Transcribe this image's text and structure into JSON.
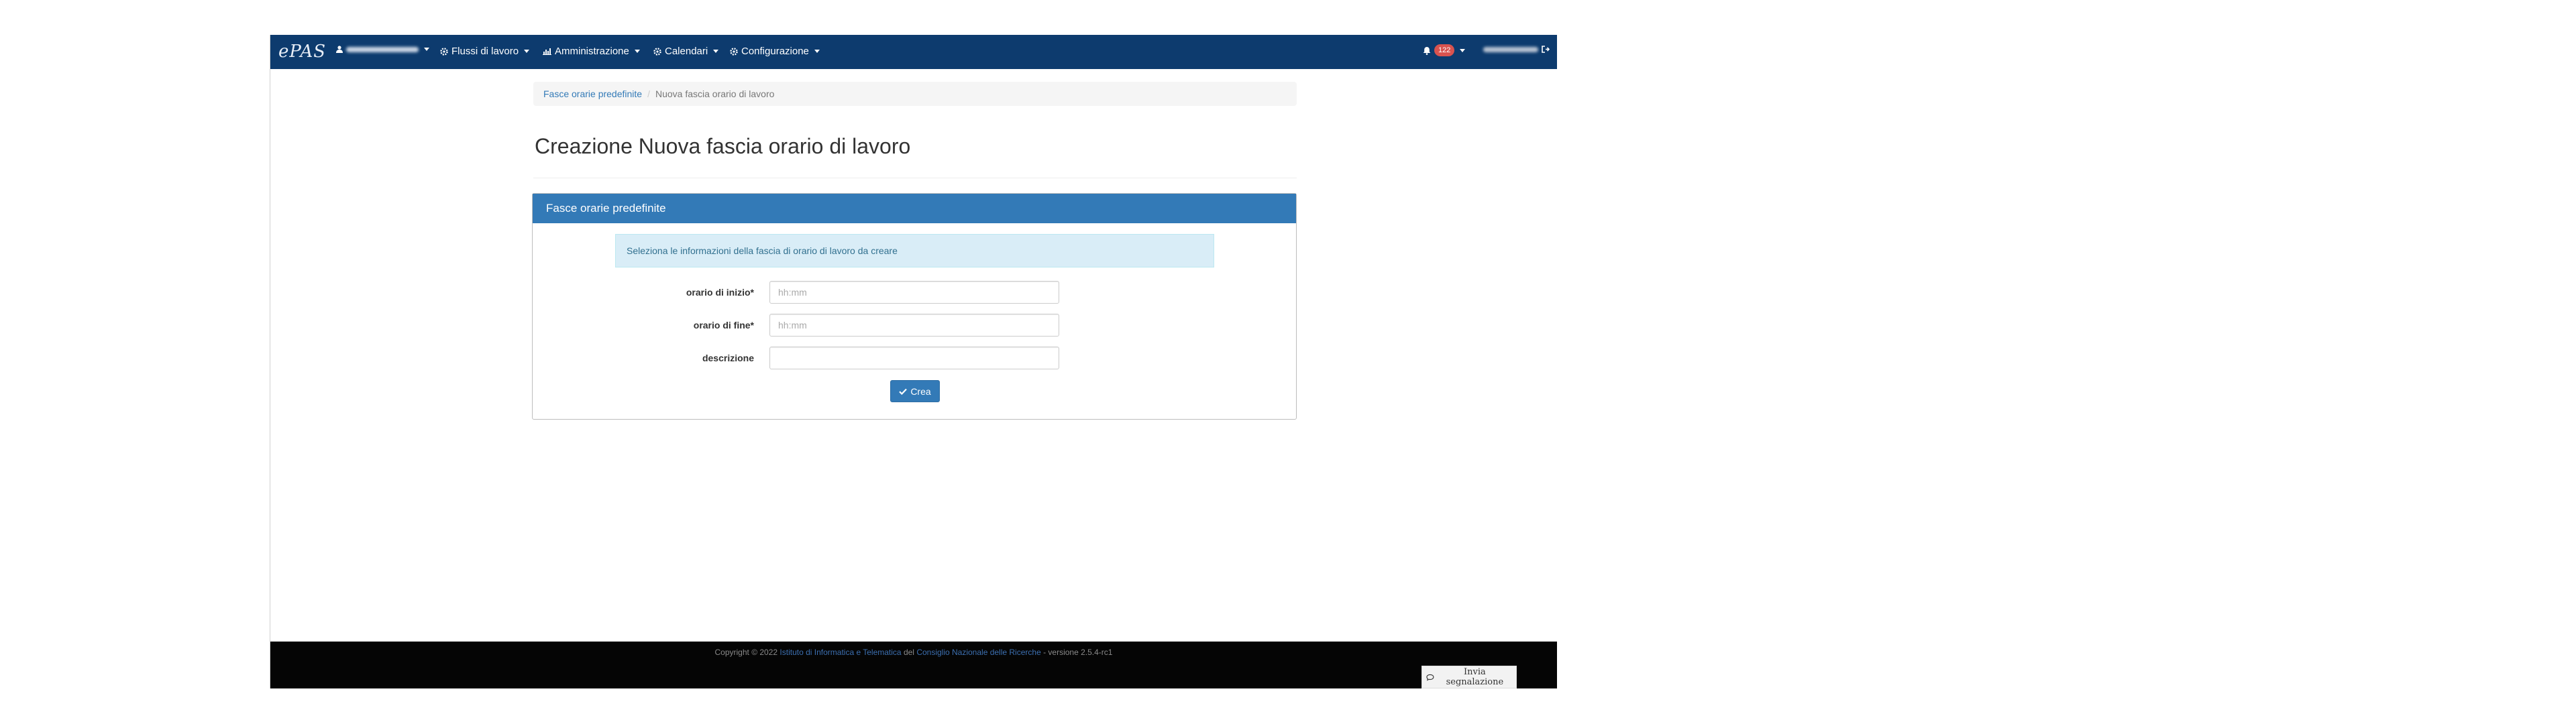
{
  "navbar": {
    "brand": "ePAS",
    "menu": [
      {
        "label": "Flussi di lavoro",
        "icon": "gear-icon"
      },
      {
        "label": "Amministrazione",
        "icon": "chart-icon"
      },
      {
        "label": "Calendari",
        "icon": "gear-icon"
      },
      {
        "label": "Configurazione",
        "icon": "gear-icon"
      }
    ],
    "notification_count": "122"
  },
  "breadcrumb": {
    "parent": "Fasce orarie predefinite",
    "current": "Nuova fascia orario di lavoro"
  },
  "page_title": "Creazione Nuova fascia orario di lavoro",
  "panel": {
    "heading": "Fasce orarie predefinite",
    "info": "Seleziona le informazioni della fascia di orario di lavoro da creare",
    "fields": {
      "start": {
        "label": "orario di inizio*",
        "placeholder": "hh:mm",
        "value": ""
      },
      "end": {
        "label": "orario di fine*",
        "placeholder": "hh:mm",
        "value": ""
      },
      "description": {
        "label": "descrizione",
        "placeholder": "",
        "value": ""
      }
    },
    "submit_label": "Crea"
  },
  "footer": {
    "copyright_prefix": "Copyright © 2022",
    "institute": "Istituto di Informatica e Telematica",
    "connector": "del",
    "council": "Consiglio Nazionale delle Ricerche",
    "version": "- versione 2.5.4-rc1",
    "report_label": "Invia segnalazione"
  },
  "colors": {
    "navbar": "#0d3b6e",
    "primary": "#337ab7",
    "badge": "#d9534f",
    "info_bg": "#d9edf7"
  }
}
